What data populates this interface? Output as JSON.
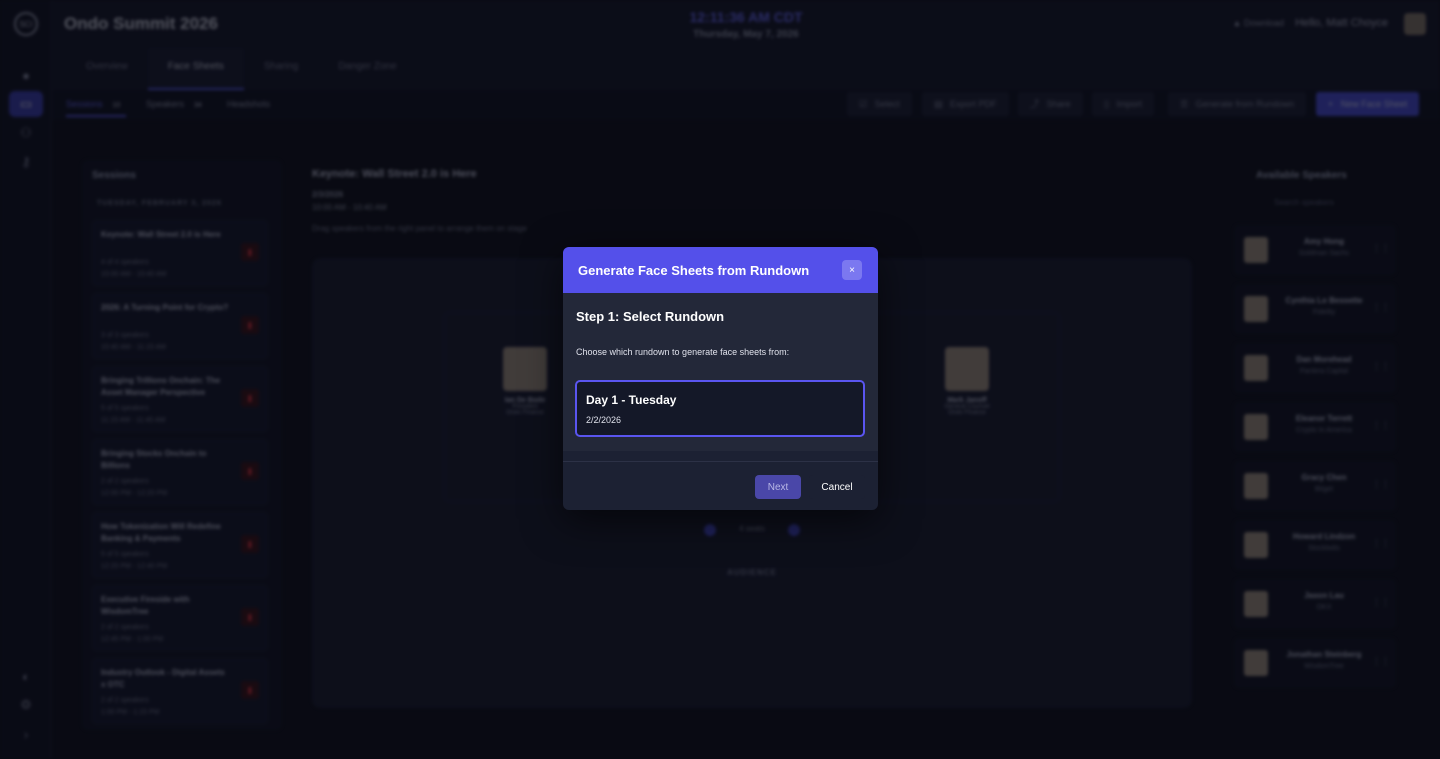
{
  "app": {
    "event_title": "Ondo Summit 2026",
    "clock": "12:11:36 AM CDT",
    "date": "Thursday, May 7, 2026",
    "download_label": "Download",
    "greeting": "Hello, Matt Choyce"
  },
  "tabs": [
    "Overview",
    "Face Sheets",
    "Sharing",
    "Danger Zone"
  ],
  "subtabs": {
    "sessions": {
      "label": "Sessions",
      "count": "10"
    },
    "speakers": {
      "label": "Speakers",
      "count": "34"
    },
    "headshots": {
      "label": "Headshots"
    }
  },
  "toolbar": {
    "select": "Select",
    "export_pdf": "Export PDF",
    "share": "Share",
    "import": "Import",
    "generate": "Generate from Rundown",
    "new_face_sheet": "New Face Sheet"
  },
  "sessions_panel": {
    "title": "Sessions",
    "day": "TUESDAY, FEBRUARY 3, 2026",
    "items": [
      {
        "title": "Keynote: Wall Street 2.0 is Here",
        "speakers": "4 of 4 speakers",
        "time": "10:00 AM - 10:40 AM"
      },
      {
        "title": "2026: A Turning Point for Crypto?",
        "speakers": "3 of 3 speakers",
        "time": "10:40 AM - 11:15 AM"
      },
      {
        "title": "Bringing Trillions Onchain: The Asset Manager Perspective",
        "speakers": "5 of 5 speakers",
        "time": "11:15 AM - 11:45 AM"
      },
      {
        "title": "Bringing Stocks Onchain to Billions",
        "speakers": "2 of 2 speakers",
        "time": "12:00 PM - 12:20 PM"
      },
      {
        "title": "How Tokenization Will Redefine Banking & Payments",
        "speakers": "5 of 5 speakers",
        "time": "12:20 PM - 12:40 PM"
      },
      {
        "title": "Executive Fireside with WisdomTree",
        "speakers": "2 of 2 speakers",
        "time": "12:45 PM - 1:00 PM"
      },
      {
        "title": "Industry Outlook - Digital Assets x OTC",
        "speakers": "2 of 2 speakers",
        "time": "1:00 PM - 1:15 PM"
      }
    ]
  },
  "session_detail": {
    "title": "Keynote: Wall Street 2.0 is Here",
    "date": "2/3/2026",
    "time": "10:00 AM - 10:40 AM",
    "hint": "Drag speakers from the right panel to arrange them on stage",
    "seat_a": {
      "num": "1",
      "name": "Ian De Bode",
      "title": "President",
      "company": "Ondo Finance"
    },
    "seat_b": {
      "num": "4",
      "name": "Mark Janoff",
      "title": "General Counsel",
      "company": "Ondo Finance"
    },
    "seats_label": "4 seats",
    "audience": "AUDIENCE"
  },
  "speakers_panel": {
    "title": "Available Speakers",
    "search_placeholder": "Search speakers",
    "items": [
      {
        "name": "Amy Hong",
        "company": "Goldman Sachs"
      },
      {
        "name": "Cynthia Lo Bessette",
        "company": "Fidelity"
      },
      {
        "name": "Dan Morehead",
        "company": "Pantera Capital"
      },
      {
        "name": "Eleanor Terrett",
        "company": "Crypto In America"
      },
      {
        "name": "Gracy Chen",
        "company": "Bitget"
      },
      {
        "name": "Howard Lindzon",
        "company": "Stocktwits"
      },
      {
        "name": "Jason Lau",
        "company": "OKX"
      },
      {
        "name": "Jonathan Steinberg",
        "company": "WisdomTree"
      }
    ]
  },
  "modal": {
    "title": "Generate Face Sheets from Rundown",
    "close": "×",
    "step_title": "Step 1: Select Rundown",
    "step_desc": "Choose which rundown to generate face sheets from:",
    "option_name": "Day 1 - Tuesday",
    "option_date": "2/2/2026",
    "next": "Next",
    "cancel": "Cancel"
  },
  "colors": {
    "accent": "#5450ea",
    "danger": "#e0303a"
  }
}
